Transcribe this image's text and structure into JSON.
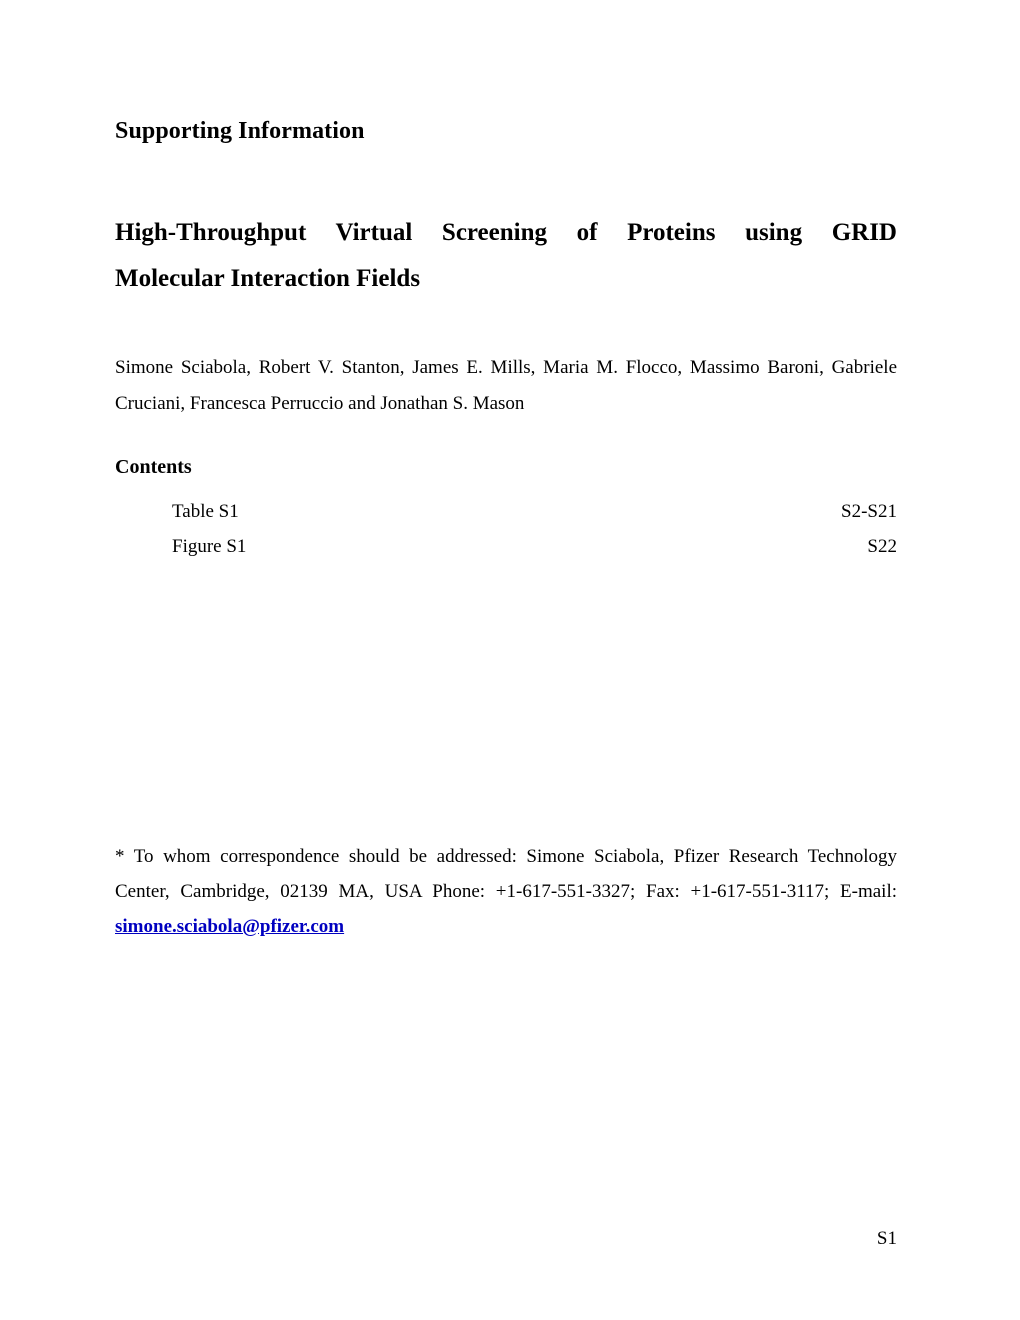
{
  "document": {
    "supporting_information_heading": "Supporting Information",
    "title_line_1": "High-Throughput Virtual Screening of Proteins using GRID",
    "title_line_2": "Molecular Interaction Fields",
    "authors_line_1": "Simone Sciabola, Robert V. Stanton, James E. Mills, Maria M. Flocco, Massimo Baroni, Gabriele",
    "authors_line_2": "Cruciani, Francesca Perruccio and Jonathan S. Mason",
    "page_number": "S1"
  },
  "contents": {
    "heading": "Contents",
    "entries": [
      {
        "label": "Table S1",
        "pages": "S2-S21"
      },
      {
        "label": "Figure S1",
        "pages": "S22"
      }
    ]
  },
  "footnote": {
    "line_1": "* To whom correspondence should be addressed: Simone Sciabola, Pfizer Research Technology",
    "line_2": "Center, Cambridge, 02139 MA, USA Phone: +1-617-551-3327; Fax: +1-617-551-3117; E-mail:",
    "email": "simone.sciabola@pfizer.com",
    "email_color": "#0000c0"
  }
}
